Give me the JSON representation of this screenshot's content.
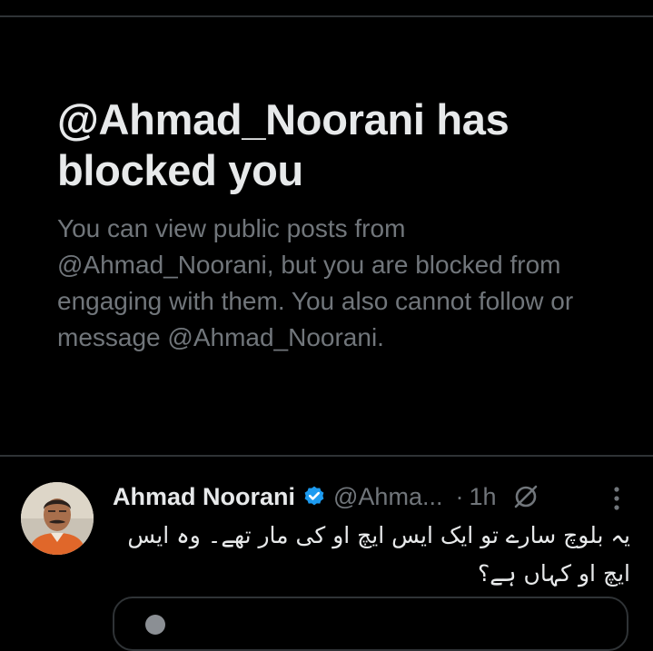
{
  "blocked": {
    "title": "@Ahmad_Noorani has blocked you",
    "description": "You can view public posts from @Ahmad_Noorani, but you are blocked from engaging with them. You also cannot follow or message @Ahmad_Noorani."
  },
  "post": {
    "author_name": "Ahmad Noorani",
    "handle": "@Ahma...",
    "separator": "·",
    "time": "1h",
    "text": "یہ بلوچ سارے تو ایک ایس ایچ او کی مار تھے۔ وہ ایس ایچ او کہاں ہے؟",
    "icons": {
      "verified": "verified-badge-icon",
      "grok": "grok-icon",
      "more": "more-options-icon"
    }
  },
  "colors": {
    "background": "#000000",
    "primary_text": "#e7e9ea",
    "secondary_text": "#71767b",
    "divider": "#2f3336",
    "verified_blue": "#1d9bf0"
  }
}
